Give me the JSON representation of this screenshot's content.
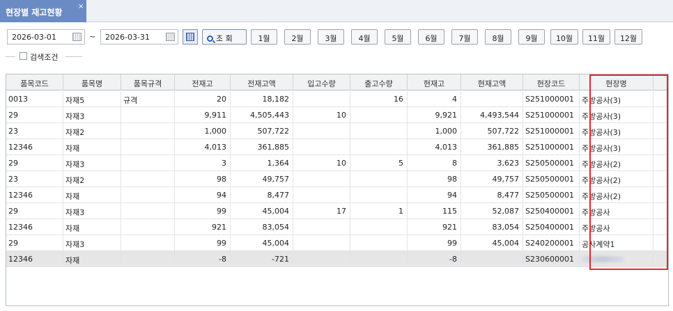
{
  "tab": {
    "title": "현장별 재고현황",
    "close": "×"
  },
  "toolbar": {
    "date_from": "2026-03-01",
    "tilde": "~",
    "date_to": "2026-03-31",
    "search_label": "조 회",
    "months": [
      "1월",
      "2월",
      "3월",
      "4월",
      "5월",
      "6월",
      "7월",
      "8월",
      "9월",
      "10월",
      "11월",
      "12월"
    ]
  },
  "condition": {
    "label": "검색조건"
  },
  "table": {
    "columns": [
      "품목코드",
      "품목명",
      "품목규격",
      "전재고",
      "전재고액",
      "입고수량",
      "출고수량",
      "현재고",
      "현재고액",
      "현장코드",
      "현장명"
    ],
    "rows": [
      [
        "0013",
        "자재5",
        "규격",
        "20",
        "18,182",
        "",
        "16",
        "4",
        "",
        "S251000001",
        "주방공사(3)"
      ],
      [
        "29",
        "자재3",
        "",
        "9,911",
        "4,505,443",
        "10",
        "",
        "9,921",
        "4,493,544",
        "S251000001",
        "주방공사(3)"
      ],
      [
        "23",
        "자재2",
        "",
        "1,000",
        "507,722",
        "",
        "",
        "1,000",
        "507,722",
        "S251000001",
        "주방공사(3)"
      ],
      [
        "12346",
        "자재",
        "",
        "4,013",
        "361,885",
        "",
        "",
        "4,013",
        "361,885",
        "S251000001",
        "주방공사(3)"
      ],
      [
        "29",
        "자재3",
        "",
        "3",
        "1,364",
        "10",
        "5",
        "8",
        "3,623",
        "S250500001",
        "주방공사(2)"
      ],
      [
        "23",
        "자재2",
        "",
        "98",
        "49,757",
        "",
        "",
        "98",
        "49,757",
        "S250500001",
        "주방공사(2)"
      ],
      [
        "12346",
        "자재",
        "",
        "94",
        "8,477",
        "",
        "",
        "94",
        "8,477",
        "S250500001",
        "주방공사(2)"
      ],
      [
        "29",
        "자재3",
        "",
        "99",
        "45,004",
        "17",
        "1",
        "115",
        "52,087",
        "S250400001",
        "주방공사"
      ],
      [
        "12346",
        "자재",
        "",
        "921",
        "83,054",
        "",
        "",
        "921",
        "83,054",
        "S250400001",
        "주방공사"
      ],
      [
        "29",
        "자재3",
        "",
        "99",
        "45,004",
        "",
        "",
        "99",
        "45,004",
        "S240200001",
        "공사계약1"
      ],
      [
        "12346",
        "자재",
        "",
        "-8",
        "-721",
        "",
        "",
        "-8",
        "",
        "S230600001",
        ""
      ]
    ]
  },
  "colors": {
    "tab_bg": "#6b8bc4",
    "highlight_border": "#e0282e",
    "selected_row": "#e6e6e6"
  }
}
